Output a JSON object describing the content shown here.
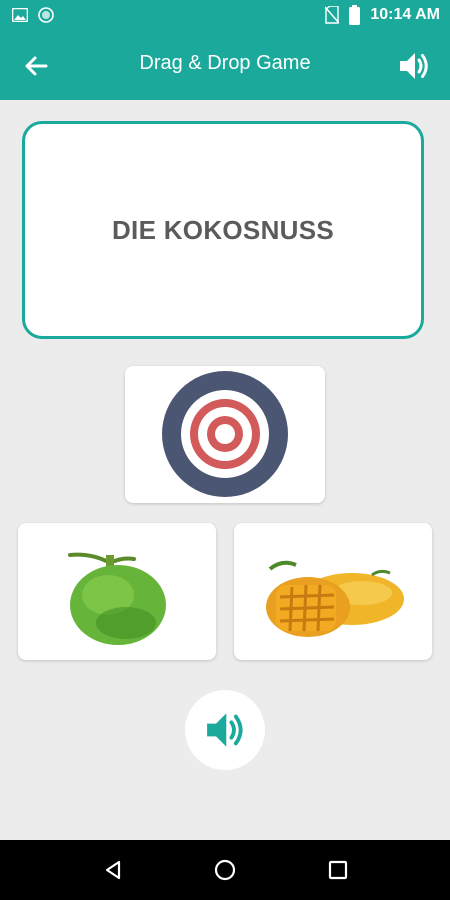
{
  "status_bar": {
    "time": "10:14 AM",
    "icons": [
      "image-icon",
      "circle-notification-icon",
      "no-sim-icon",
      "battery-icon"
    ]
  },
  "app_bar": {
    "title": "Drag & Drop Game",
    "back_icon": "arrow-left-icon",
    "sound_icon": "speaker-icon"
  },
  "word_card": {
    "text": "DIE KOKOSNUSS"
  },
  "drop_target": {
    "icon": "target-icon"
  },
  "options": [
    {
      "image": "coconut-image"
    },
    {
      "image": "mango-image"
    }
  ],
  "play_sound_button": {
    "icon": "speaker-icon"
  },
  "nav_bar": {
    "buttons": [
      "back-triangle-icon",
      "home-circle-icon",
      "recents-square-icon"
    ]
  },
  "colors": {
    "primary": "#1aa99b",
    "background": "#ececec",
    "word_text": "#5b5b5b",
    "target_ring": "#4a5672",
    "target_red": "#d25a5a"
  }
}
